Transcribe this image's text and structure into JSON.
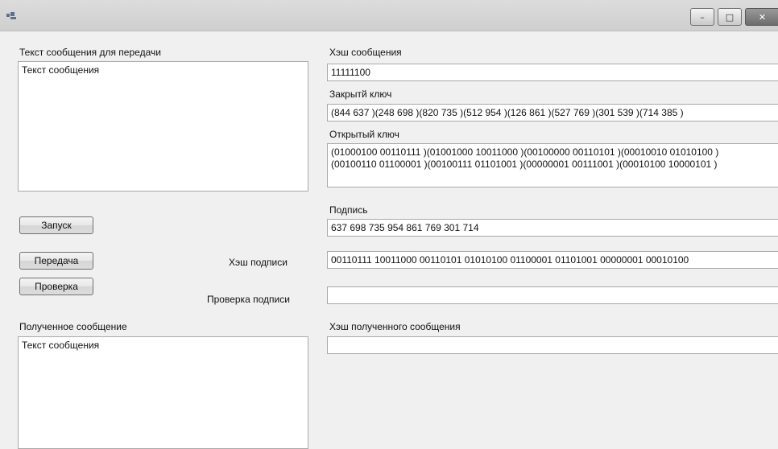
{
  "window": {
    "title": "",
    "min_glyph": "–",
    "max_glyph": "□",
    "close_glyph": "✕"
  },
  "left": {
    "message_label": "Текст сообщения для передачи",
    "message_text": "Текст сообщения",
    "buttons": {
      "run": "Запуск",
      "send": "Передача",
      "verify": "Проверка"
    },
    "signature_hash_label": "Хэш подписи",
    "signature_check_label": "Проверка подписи",
    "received_label": "Полученное сообщение",
    "received_text": "Текст сообщения"
  },
  "right": {
    "message_hash_label": "Хэш сообщения",
    "message_hash_value": "11111100",
    "private_key_label": "Закрытй ключ",
    "private_key_value": "(844 637 )(248 698 )(820 735 )(512 954 )(126 861 )(527 769 )(301 539 )(714 385 )",
    "public_key_label": "Открытый ключ",
    "public_key_value": "(01000100 00110111 )(01001000 10011000 )(00100000 00110101 )(00010010 01010100 )\n(00100110 01100001 )(00100111 01101001 )(00000001 00111001 )(00010100 10000101 )",
    "signature_label": "Подпись",
    "signature_value": "637 698 735 954 861 769 301 714",
    "signature_hash_value": "00110111 10011000 00110101 01010100 01100001 01101001 00000001 00010100",
    "signature_check_value": "",
    "received_hash_label": "Хэш полученного сообщения",
    "received_hash_value": ""
  }
}
